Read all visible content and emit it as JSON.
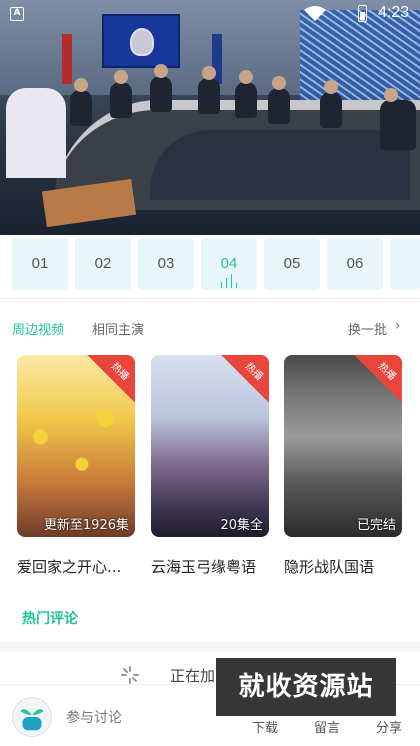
{
  "status_bar": {
    "time": "4:23",
    "icons": [
      "notification-a-icon",
      "wifi-icon",
      "battery-icon"
    ]
  },
  "video": {
    "description_icon": "video-player"
  },
  "episodes": [
    {
      "label": "01",
      "active": false
    },
    {
      "label": "02",
      "active": false
    },
    {
      "label": "03",
      "active": false
    },
    {
      "label": "04",
      "active": true
    },
    {
      "label": "05",
      "active": false
    },
    {
      "label": "06",
      "active": false
    }
  ],
  "tabs": {
    "nearby": "周边视频",
    "cast": "相同主演",
    "refresh": "换一批",
    "refresh_icon": "chevron-right-icon"
  },
  "posters": [
    {
      "title": "爱回家之开心...",
      "badge": "热播",
      "note": "更新至1926集"
    },
    {
      "title": "云海玉弓缘粤语",
      "badge": "热播",
      "note": "20集全"
    },
    {
      "title": "隐形战队国语",
      "badge": "热播",
      "note": "已完结"
    }
  ],
  "hot_comments": "热门评论",
  "loading": {
    "text": "正在加"
  },
  "bottom": {
    "discuss": "参与讨论",
    "download": "下载",
    "comment": "留言",
    "share": "分享"
  },
  "watermark": "就收资源站",
  "colors": {
    "accent": "#21c497",
    "hot_badge": "#e8453c",
    "episode_bg": "#e9f6f8"
  }
}
